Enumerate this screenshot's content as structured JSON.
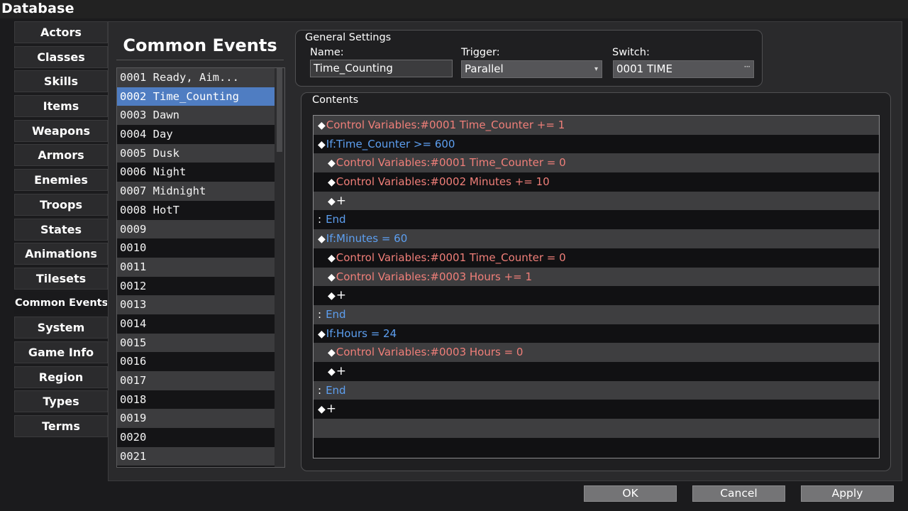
{
  "window": {
    "title": "Database"
  },
  "tabs": [
    {
      "label": "Actors"
    },
    {
      "label": "Classes"
    },
    {
      "label": "Skills"
    },
    {
      "label": "Items"
    },
    {
      "label": "Weapons"
    },
    {
      "label": "Armors"
    },
    {
      "label": "Enemies"
    },
    {
      "label": "Troops"
    },
    {
      "label": "States"
    },
    {
      "label": "Animations"
    },
    {
      "label": "Tilesets"
    },
    {
      "label": "Common Events"
    },
    {
      "label": "System"
    },
    {
      "label": "Game Info"
    },
    {
      "label": "Region"
    },
    {
      "label": "Types"
    },
    {
      "label": "Terms"
    }
  ],
  "active_tab": "Common Events",
  "list": {
    "title": "Common Events",
    "selected_index": 1,
    "items": [
      "0001 Ready, Aim...",
      "0002 Time_Counting",
      "0003 Dawn",
      "0004 Day",
      "0005 Dusk",
      "0006 Night",
      "0007 Midnight",
      "0008 HotT",
      "0009",
      "0010",
      "0011",
      "0012",
      "0013",
      "0014",
      "0015",
      "0016",
      "0017",
      "0018",
      "0019",
      "0020",
      "0021"
    ]
  },
  "general_settings": {
    "title": "General Settings",
    "name_label": "Name:",
    "name_value": "Time_Counting",
    "trigger_label": "Trigger:",
    "trigger_value": "Parallel",
    "switch_label": "Switch:",
    "switch_value": "0001 TIME"
  },
  "contents": {
    "title": "Contents",
    "rows": [
      {
        "kind": "var",
        "indent": 0,
        "text": "Control Variables:#0001 Time_Counter += 1"
      },
      {
        "kind": "if",
        "indent": 0,
        "text": "If:Time_Counter >= 600"
      },
      {
        "kind": "var",
        "indent": 1,
        "text": "Control Variables:#0001 Time_Counter = 0"
      },
      {
        "kind": "var",
        "indent": 1,
        "text": "Control Variables:#0002 Minutes += 10"
      },
      {
        "kind": "plus",
        "indent": 1,
        "text": "+"
      },
      {
        "kind": "end",
        "indent": 0,
        "text": "End"
      },
      {
        "kind": "if",
        "indent": 0,
        "text": "If:Minutes = 60"
      },
      {
        "kind": "var",
        "indent": 1,
        "text": "Control Variables:#0001 Time_Counter = 0"
      },
      {
        "kind": "var",
        "indent": 1,
        "text": "Control Variables:#0003 Hours += 1"
      },
      {
        "kind": "plus",
        "indent": 1,
        "text": "+"
      },
      {
        "kind": "end",
        "indent": 0,
        "text": "End"
      },
      {
        "kind": "if",
        "indent": 0,
        "text": "If:Hours = 24"
      },
      {
        "kind": "var",
        "indent": 1,
        "text": "Control Variables:#0003 Hours = 0"
      },
      {
        "kind": "plus",
        "indent": 1,
        "text": "+"
      },
      {
        "kind": "end",
        "indent": 0,
        "text": "End"
      },
      {
        "kind": "plus",
        "indent": 0,
        "text": "+"
      },
      {
        "kind": "blank",
        "indent": 0,
        "text": ""
      },
      {
        "kind": "blank",
        "indent": 0,
        "text": ""
      }
    ]
  },
  "buttons": {
    "ok": "OK",
    "cancel": "Cancel",
    "apply": "Apply"
  },
  "colors": {
    "selected": "#4f7dc2",
    "variable_text": "#f07f79",
    "branch_text": "#5d9ff0"
  },
  "icons": {
    "command_marker": "diamond-icon",
    "dropdown": "chevron-down-icon",
    "picker": "ellipsis-icon"
  }
}
